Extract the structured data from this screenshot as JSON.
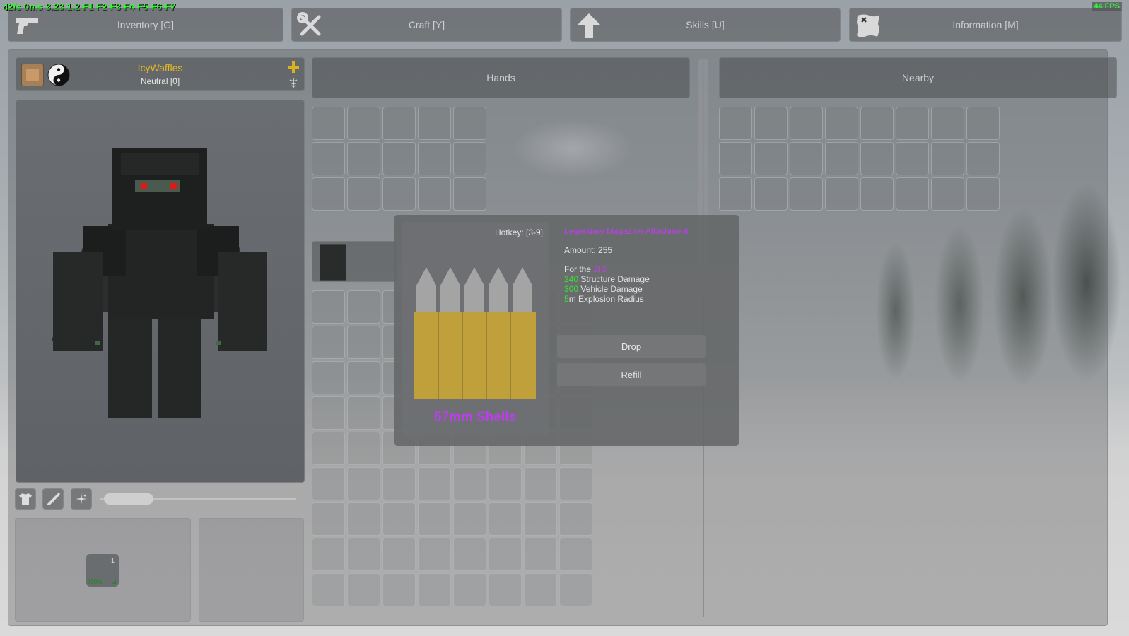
{
  "debug": {
    "text": "42/s 0ms 3.23.1.2 F1 F2 F3 F4 F5 F6 F7",
    "fps": "44 FPS"
  },
  "menu": [
    {
      "label": "Inventory [G]",
      "icon": "pistol-icon"
    },
    {
      "label": "Craft [Y]",
      "icon": "tools-icon"
    },
    {
      "label": "Skills [U]",
      "icon": "arrow-up-icon"
    },
    {
      "label": "Information [M]",
      "icon": "map-icon"
    }
  ],
  "player": {
    "name": "IcyWaffles",
    "reputation": "Neutral [0]",
    "name_color": "#e8b820"
  },
  "panels": {
    "hands": "Hands",
    "nearby": "Nearby"
  },
  "equipped_slot": {
    "count": "1",
    "quality": "100%"
  },
  "tooltip": {
    "hotkey": "Hotkey: [3-9]",
    "rarity_title": "Legendary Magazine Attachment",
    "amount": "Amount: 255",
    "for_prefix": "For the ",
    "for_weapon": "ZIS",
    "structure_value": "240",
    "structure_label": " Structure Damage",
    "vehicle_value": "300",
    "vehicle_label": " Vehicle Damage",
    "radius_value": "5",
    "radius_label": "m Explosion Radius",
    "item_name": "57mm Shells",
    "drop_label": "Drop",
    "refill_label": "Refill",
    "item_icon": "shells-icon"
  },
  "colors": {
    "legendary": "#c03cf0",
    "stat": "#36e236",
    "debug": "#2aff2a"
  },
  "zoom_slider": 0.25
}
